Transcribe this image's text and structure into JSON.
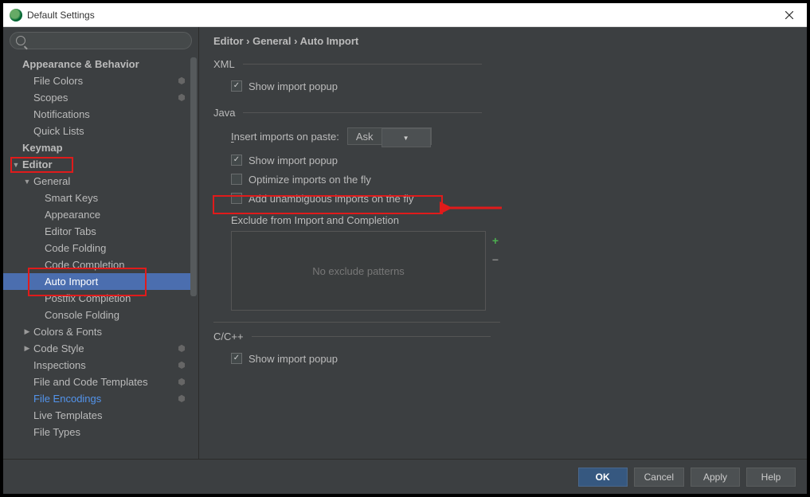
{
  "window": {
    "title": "Default Settings"
  },
  "breadcrumb": "Editor › General › Auto Import",
  "sidebar": {
    "items": [
      {
        "label": "Appearance & Behavior",
        "indent": 1,
        "bold": true,
        "arrow": ""
      },
      {
        "label": "File Colors",
        "indent": 2,
        "badge": true
      },
      {
        "label": "Scopes",
        "indent": 2,
        "badge": true
      },
      {
        "label": "Notifications",
        "indent": 2
      },
      {
        "label": "Quick Lists",
        "indent": 2
      },
      {
        "label": "Keymap",
        "indent": 1,
        "bold": true
      },
      {
        "label": "Editor",
        "indent": 1,
        "bold": true,
        "arrow": "▼",
        "hl": true
      },
      {
        "label": "General",
        "indent": 2,
        "arrow": "▼"
      },
      {
        "label": "Smart Keys",
        "indent": 3
      },
      {
        "label": "Appearance",
        "indent": 3
      },
      {
        "label": "Editor Tabs",
        "indent": 3
      },
      {
        "label": "Code Folding",
        "indent": 3
      },
      {
        "label": "Code Completion",
        "indent": 3
      },
      {
        "label": "Auto Import",
        "indent": 3,
        "selected": true,
        "hl": true
      },
      {
        "label": "Postfix Completion",
        "indent": 3
      },
      {
        "label": "Console Folding",
        "indent": 3
      },
      {
        "label": "Colors & Fonts",
        "indent": 2,
        "arrow": "▶"
      },
      {
        "label": "Code Style",
        "indent": 2,
        "arrow": "▶",
        "badge": true
      },
      {
        "label": "Inspections",
        "indent": 2,
        "badge": true
      },
      {
        "label": "File and Code Templates",
        "indent": 2,
        "badge": true
      },
      {
        "label": "File Encodings",
        "indent": 2,
        "link": true,
        "badge": true
      },
      {
        "label": "Live Templates",
        "indent": 2
      },
      {
        "label": "File Types",
        "indent": 2
      }
    ]
  },
  "content": {
    "xml": {
      "title": "XML",
      "show_popup": "Show import popup",
      "show_popup_checked": true
    },
    "java": {
      "title": "Java",
      "insert_label": "Insert imports on paste:",
      "insert_value": "Ask",
      "show_popup": "Show import popup",
      "show_popup_checked": true,
      "optimize": "Optimize imports on the fly",
      "optimize_checked": false,
      "unambiguous": "Add unambiguous imports on the fly",
      "unambiguous_checked": false,
      "exclude_label": "Exclude from Import and Completion",
      "exclude_placeholder": "No exclude patterns"
    },
    "cpp": {
      "title": "C/C++",
      "show_popup": "Show import popup",
      "show_popup_checked": true
    }
  },
  "footer": {
    "ok": "OK",
    "cancel": "Cancel",
    "apply": "Apply",
    "help": "Help"
  }
}
